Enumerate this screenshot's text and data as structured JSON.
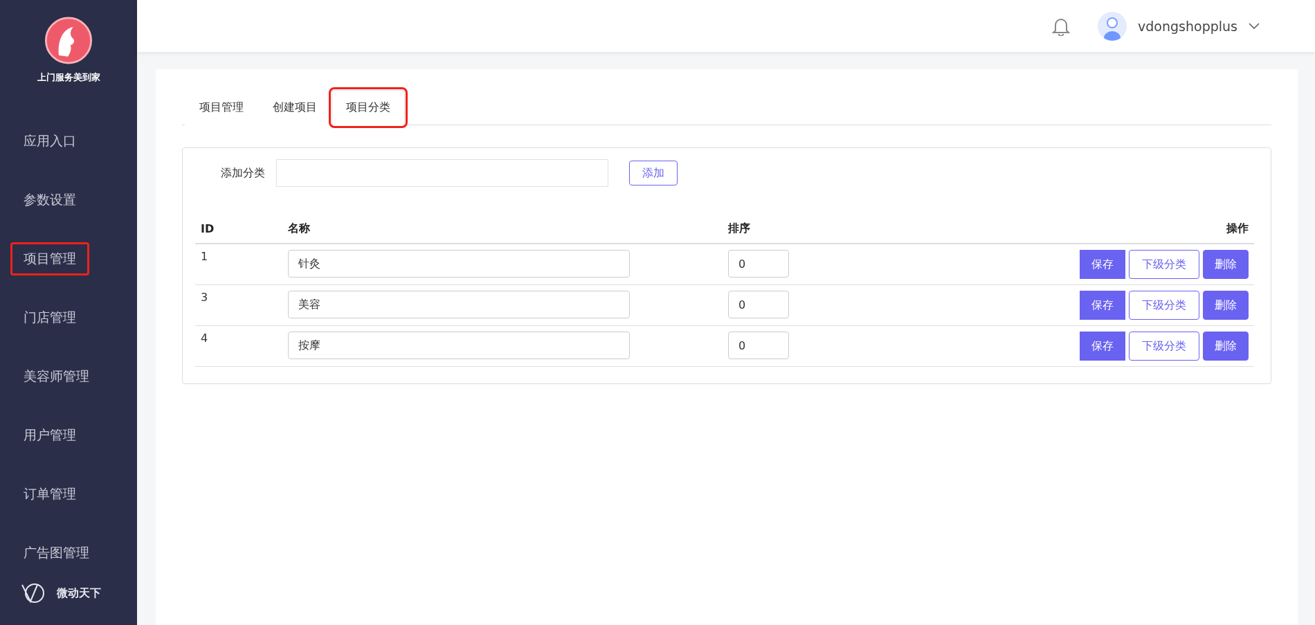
{
  "sidebar": {
    "brand": "上门服务美到家",
    "items": [
      {
        "label": "应用入口",
        "highlighted": false
      },
      {
        "label": "参数设置",
        "highlighted": false
      },
      {
        "label": "项目管理",
        "highlighted": true
      },
      {
        "label": "门店管理",
        "highlighted": false
      },
      {
        "label": "美容师管理",
        "highlighted": false
      },
      {
        "label": "用户管理",
        "highlighted": false
      },
      {
        "label": "订单管理",
        "highlighted": false
      },
      {
        "label": "广告图管理",
        "highlighted": false
      }
    ],
    "footer": "微动天下"
  },
  "header": {
    "username": "vdongshopplus"
  },
  "tabs": [
    {
      "label": "项目管理",
      "selected": false,
      "highlighted": false
    },
    {
      "label": "创建项目",
      "selected": false,
      "highlighted": false
    },
    {
      "label": "项目分类",
      "selected": true,
      "highlighted": true
    }
  ],
  "add_form": {
    "label": "添加分类",
    "button": "添加"
  },
  "table": {
    "columns": [
      "ID",
      "名称",
      "排序",
      "操作"
    ],
    "rows": [
      {
        "id": "1",
        "name": "针灸",
        "order": "0",
        "actions": [
          "保存",
          "下级分类",
          "删除"
        ]
      },
      {
        "id": "3",
        "name": "美容",
        "order": "0",
        "actions": [
          "保存",
          "下级分类",
          "删除"
        ]
      },
      {
        "id": "4",
        "name": "按摩",
        "order": "0",
        "actions": [
          "保存",
          "下级分类",
          "删除"
        ]
      }
    ]
  }
}
